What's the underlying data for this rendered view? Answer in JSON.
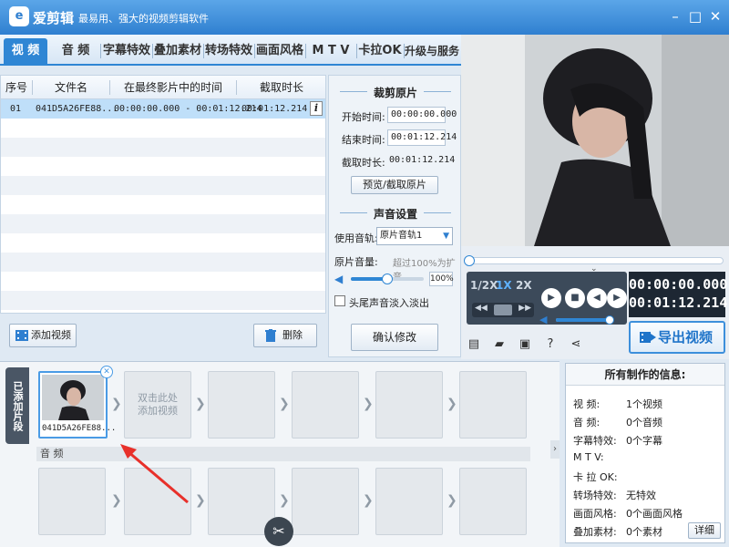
{
  "app": {
    "name": "爱剪辑",
    "slogan": "最易用、强大的视频剪辑软件",
    "logo_char": "e"
  },
  "window_controls": {
    "minimize": "–",
    "maximize": "□",
    "close": "✕"
  },
  "tabs": [
    {
      "label": "视 频",
      "active": true
    },
    {
      "label": "音 频"
    },
    {
      "label": "字幕特效"
    },
    {
      "label": "叠加素材"
    },
    {
      "label": "转场特效"
    },
    {
      "label": "画面风格"
    },
    {
      "label": "M T V"
    },
    {
      "label": "卡拉OK"
    },
    {
      "label": "升级与服务"
    }
  ],
  "video_list": {
    "columns": [
      "序号",
      "文件名",
      "在最终影片中的时间",
      "截取时长"
    ],
    "rows": [
      {
        "index": "01",
        "filename": "041D5A26FE88...",
        "time_range": "00:00:00.000 - 00:01:12.214",
        "duration": "00:01:12.214"
      }
    ],
    "info_glyph": "i"
  },
  "list_buttons": {
    "add_video": "添加视频",
    "delete": "删除"
  },
  "clip_settings": {
    "title": "裁剪原片",
    "start_label": "开始时间:",
    "start_value": "00:00:00.000",
    "end_label": "结束时间:",
    "end_value": "00:01:12.214",
    "duration_label": "截取时长:",
    "duration_value": "00:01:12.214",
    "preview_button": "预览/截取原片"
  },
  "audio_settings": {
    "title": "声音设置",
    "track_label": "使用音轨:",
    "track_value": "原片音轨1",
    "volume_label": "原片音量:",
    "volume_hint": "超过100%为扩音",
    "volume_value": "100%",
    "volume_fraction": 0.5,
    "fade_label": "头尾声音淡入淡出",
    "fade_checked": false
  },
  "confirm_button": "确认修改",
  "player": {
    "speeds": [
      "1/2X",
      "1X",
      "2X"
    ],
    "active_speed": "1X",
    "current_time": "00:00:00.000",
    "total_time": "00:01:12.214",
    "volume_fraction": 0.95,
    "export_button": "导出视频"
  },
  "timeline": {
    "label": "已添加片段",
    "clip_thumb_label": "041D5A26FE88...",
    "empty_slot_text": "双击此处\n添加视频",
    "audio_label": "音 频"
  },
  "production_info": {
    "title": "所有制作的信息:",
    "rows": [
      {
        "key": "视    频:",
        "value": "1个视频"
      },
      {
        "key": "音    频:",
        "value": "0个音频"
      },
      {
        "key": "字幕特效:",
        "value": "0个字幕"
      },
      {
        "key": "M  T  V:",
        "value": ""
      },
      {
        "key": "卡 拉 OK:",
        "value": ""
      },
      {
        "key": "转场特效:",
        "value": "无特效"
      },
      {
        "key": "画面风格:",
        "value": "0个画面风格"
      },
      {
        "key": "叠加素材:",
        "value": "0个素材"
      }
    ],
    "detail_button": "详细"
  },
  "colors": {
    "accent": "#2f86d4",
    "selected_row": "#bfdff9",
    "annotation_arrow": "#e8302a"
  }
}
